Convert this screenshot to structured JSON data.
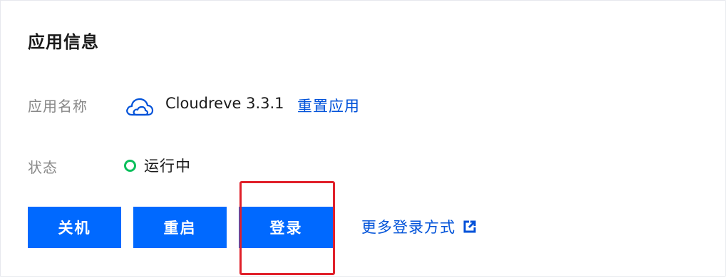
{
  "section": {
    "title": "应用信息"
  },
  "fields": {
    "name_label": "应用名称",
    "status_label": "状态"
  },
  "app": {
    "icon": "cloud-icon",
    "name": "Cloudreve 3.3.1",
    "reset_label": "重置应用"
  },
  "status": {
    "text": "运行中",
    "color": "#0abf5b"
  },
  "actions": {
    "shutdown_label": "关机",
    "restart_label": "重启",
    "login_label": "登录",
    "more_login_label": "更多登录方式",
    "more_login_icon": "external-link-icon"
  },
  "colors": {
    "primary": "#0069ff",
    "link": "#0052d9",
    "highlight": "#e0202a"
  }
}
